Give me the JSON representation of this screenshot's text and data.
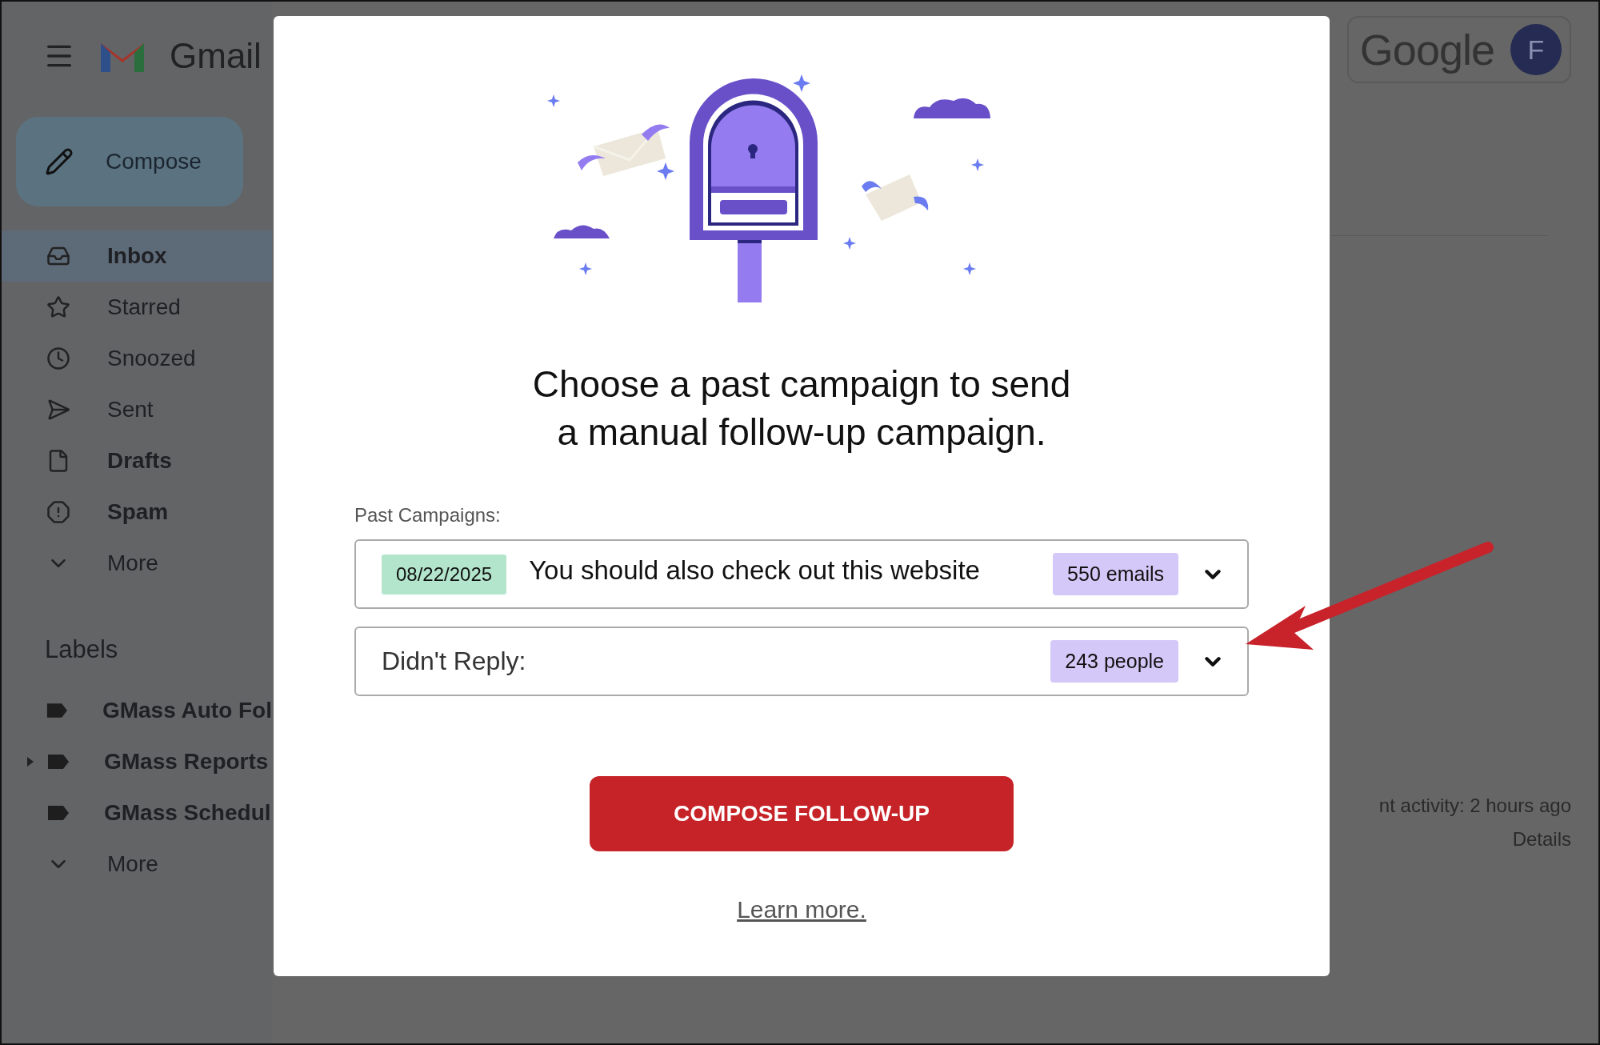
{
  "app": {
    "brand": "Gmail",
    "compose": "Compose"
  },
  "nav": [
    {
      "label": "Inbox",
      "unread": true,
      "selected": true
    },
    {
      "label": "Starred",
      "unread": false,
      "selected": false
    },
    {
      "label": "Snoozed",
      "unread": false,
      "selected": false
    },
    {
      "label": "Sent",
      "unread": false,
      "selected": false
    },
    {
      "label": "Drafts",
      "unread": true,
      "selected": false
    },
    {
      "label": "Spam",
      "unread": true,
      "selected": false
    },
    {
      "label": "More",
      "unread": false,
      "selected": false
    }
  ],
  "labels": {
    "heading": "Labels",
    "items": [
      {
        "label": "GMass Auto Fol",
        "expandable": false
      },
      {
        "label": "GMass Reports",
        "expandable": true
      },
      {
        "label": "GMass Schedul",
        "expandable": false
      }
    ],
    "more": "More"
  },
  "account": {
    "logo": "Google",
    "avatar": "F"
  },
  "background": {
    "activity": "nt activity: 2 hours ago",
    "details": "Details"
  },
  "modal": {
    "title": "Choose a past campaign to send a manual follow-up campaign.",
    "field_label": "Past Campaigns:",
    "dropdowns": [
      {
        "kind": "campaign",
        "date": "08/22/2025",
        "subject": "You should also check out this website",
        "count": "550 emails"
      },
      {
        "kind": "filter",
        "label": "Didn't Reply:",
        "count": "243 people"
      }
    ],
    "button": "COMPOSE FOLLOW-UP",
    "link": "Learn more."
  }
}
